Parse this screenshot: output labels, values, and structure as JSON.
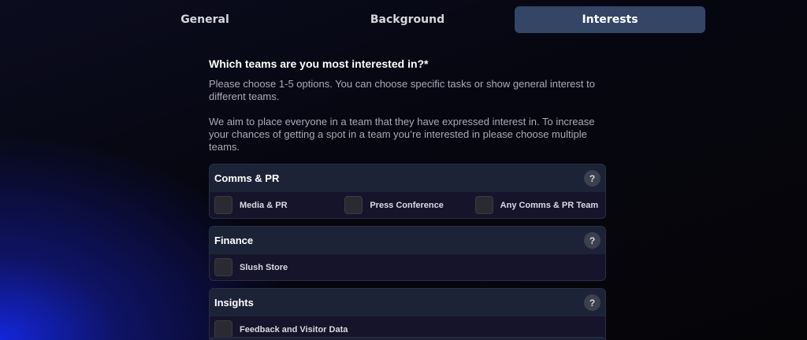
{
  "tabs": [
    {
      "label": "General",
      "active": false
    },
    {
      "label": "Background",
      "active": false
    },
    {
      "label": "Interests",
      "active": true
    }
  ],
  "question": {
    "title": "Which teams are you most interested in?*",
    "help1": "Please choose 1-5 options. You can choose specific tasks or show general interest to different teams.",
    "help2": "We aim to place everyone in a team that they have expressed interest in. To increase your chances of getting a spot in a team you’re interested in please choose multiple teams."
  },
  "groups": [
    {
      "title": "Comms & PR",
      "help_icon": "?",
      "options": [
        {
          "label": "Media & PR",
          "checked": false
        },
        {
          "label": "Press Conference",
          "checked": false
        },
        {
          "label": "Any Comms & PR Team",
          "checked": false
        }
      ]
    },
    {
      "title": "Finance",
      "help_icon": "?",
      "options": [
        {
          "label": "Slush Store",
          "checked": false
        }
      ]
    },
    {
      "title": "Insights",
      "help_icon": "?",
      "options": [
        {
          "label": "Feedback and Visitor Data",
          "checked": false
        }
      ]
    }
  ],
  "colors": {
    "active_tab": "#354566",
    "group_header": "#1d2337",
    "background_glow": "#1428e6"
  }
}
